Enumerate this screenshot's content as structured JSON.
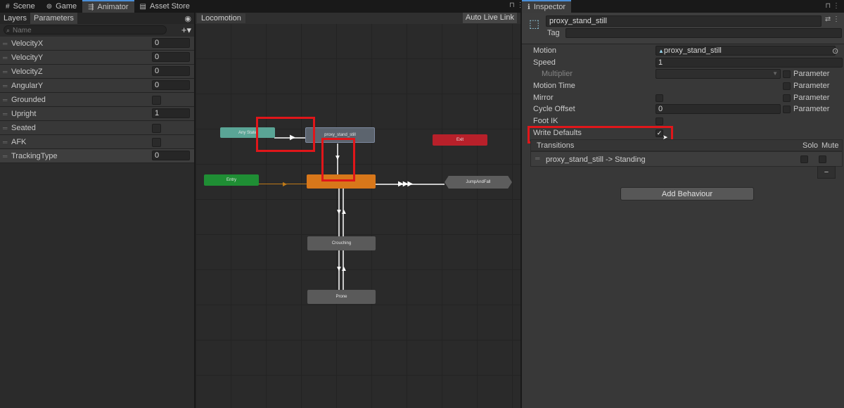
{
  "tabs": {
    "scene": "Scene",
    "game": "Game",
    "animator": "Animator",
    "asset_store": "Asset Store"
  },
  "animator": {
    "subtabs": {
      "layers": "Layers",
      "parameters": "Parameters"
    },
    "search_placeholder": "Name",
    "parameters": [
      {
        "name": "VelocityX",
        "value": "0"
      },
      {
        "name": "VelocityY",
        "value": "0"
      },
      {
        "name": "VelocityZ",
        "value": "0"
      },
      {
        "name": "AngularY",
        "value": "0"
      },
      {
        "name": "Grounded",
        "value": null
      },
      {
        "name": "Upright",
        "value": "1"
      },
      {
        "name": "Seated",
        "value": null
      },
      {
        "name": "AFK",
        "value": null
      },
      {
        "name": "TrackingType",
        "value": "0"
      }
    ],
    "layer_name": "Locomotion",
    "auto_live_link": "Auto Live Link",
    "nodes": {
      "any_state": "Any State",
      "proxy": "proxy_stand_still",
      "exit": "Exit",
      "entry": "Entry",
      "jump": "JumpAndFall",
      "crouching": "Crouching",
      "prone": "Prone"
    }
  },
  "inspector": {
    "tab": "Inspector",
    "object_name": "proxy_stand_still",
    "tag_label": "Tag",
    "motion_label": "Motion",
    "motion_value": "proxy_stand_still",
    "speed_label": "Speed",
    "speed_value": "1",
    "multiplier_label": "Multiplier",
    "motion_time_label": "Motion Time",
    "mirror_label": "Mirror",
    "cycle_offset_label": "Cycle Offset",
    "cycle_offset_value": "0",
    "foot_ik_label": "Foot IK",
    "write_defaults_label": "Write Defaults",
    "parameter_label": "Parameter",
    "transitions_label": "Transitions",
    "solo_label": "Solo",
    "mute_label": "Mute",
    "transition": "proxy_stand_still -> Standing",
    "minus": "−",
    "add_behaviour": "Add Behaviour"
  }
}
